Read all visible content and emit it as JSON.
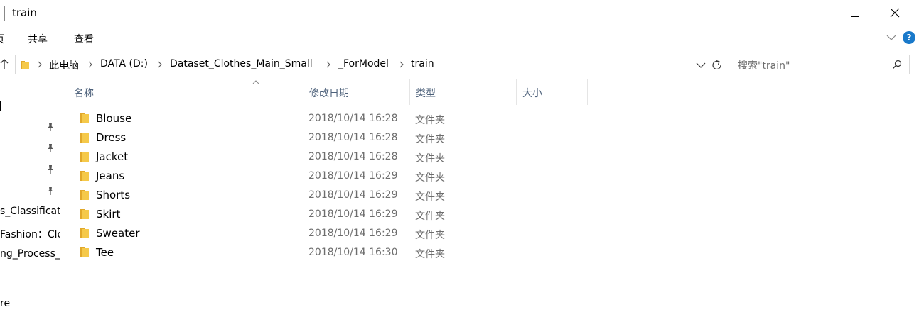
{
  "window": {
    "title": "train"
  },
  "ribbon": {
    "tabs": [
      "页",
      "共享",
      "查看"
    ],
    "help_label": "?"
  },
  "address": {
    "crumbs": [
      "此电脑",
      "DATA (D:)",
      "Dataset_Clothes_Main_Small",
      "_ForModel",
      "train"
    ]
  },
  "search": {
    "placeholder": "搜索\"train\""
  },
  "nav_pane": {
    "items": [
      "s_Classificat",
      "Fashion：Clo",
      "ng_Process_",
      "re"
    ]
  },
  "columns": {
    "name": "名称",
    "modified": "修改日期",
    "type": "类型",
    "size": "大小"
  },
  "files": [
    {
      "name": "Blouse",
      "modified": "2018/10/14 16:28",
      "type": "文件夹"
    },
    {
      "name": "Dress",
      "modified": "2018/10/14 16:28",
      "type": "文件夹"
    },
    {
      "name": "Jacket",
      "modified": "2018/10/14 16:28",
      "type": "文件夹"
    },
    {
      "name": "Jeans",
      "modified": "2018/10/14 16:29",
      "type": "文件夹"
    },
    {
      "name": "Shorts",
      "modified": "2018/10/14 16:29",
      "type": "文件夹"
    },
    {
      "name": "Skirt",
      "modified": "2018/10/14 16:29",
      "type": "文件夹"
    },
    {
      "name": "Sweater",
      "modified": "2018/10/14 16:29",
      "type": "文件夹"
    },
    {
      "name": "Tee",
      "modified": "2018/10/14 16:30",
      "type": "文件夹"
    }
  ],
  "colors": {
    "folder": "#f5c94a",
    "folder_dark": "#e1a82a",
    "header_text": "#4c607a",
    "help_bg": "#1979ca"
  }
}
